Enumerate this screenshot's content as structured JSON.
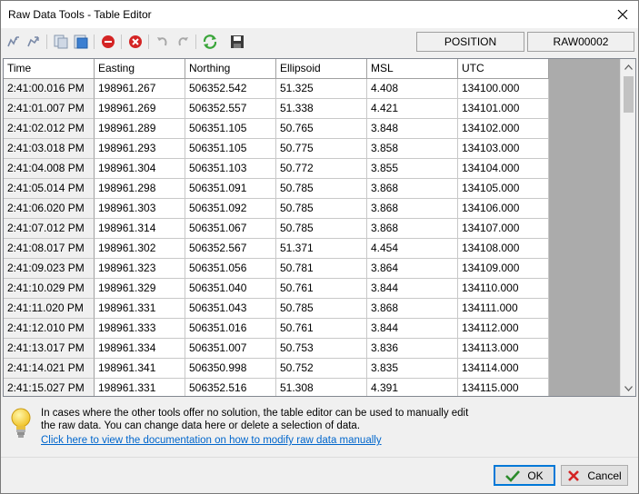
{
  "window": {
    "title": "Raw Data Tools - Table Editor"
  },
  "toolbar": {
    "position_label": "POSITION",
    "record_label": "RAW00002",
    "icons": [
      "split-icon",
      "merge-icon",
      "copy-icon",
      "paste-icon",
      "stop-icon",
      "delete-icon",
      "undo-icon",
      "redo-icon",
      "refresh-icon",
      "save-icon"
    ]
  },
  "table": {
    "columns": [
      "Time",
      "Easting",
      "Northing",
      "Ellipsoid",
      "MSL",
      "UTC"
    ],
    "rows": [
      [
        "2:41:00.016 PM",
        "198961.267",
        "506352.542",
        "51.325",
        "4.408",
        "134100.000"
      ],
      [
        "2:41:01.007 PM",
        "198961.269",
        "506352.557",
        "51.338",
        "4.421",
        "134101.000"
      ],
      [
        "2:41:02.012 PM",
        "198961.289",
        "506351.105",
        "50.765",
        "3.848",
        "134102.000"
      ],
      [
        "2:41:03.018 PM",
        "198961.293",
        "506351.105",
        "50.775",
        "3.858",
        "134103.000"
      ],
      [
        "2:41:04.008 PM",
        "198961.304",
        "506351.103",
        "50.772",
        "3.855",
        "134104.000"
      ],
      [
        "2:41:05.014 PM",
        "198961.298",
        "506351.091",
        "50.785",
        "3.868",
        "134105.000"
      ],
      [
        "2:41:06.020 PM",
        "198961.303",
        "506351.092",
        "50.785",
        "3.868",
        "134106.000"
      ],
      [
        "2:41:07.012 PM",
        "198961.314",
        "506351.067",
        "50.785",
        "3.868",
        "134107.000"
      ],
      [
        "2:41:08.017 PM",
        "198961.302",
        "506352.567",
        "51.371",
        "4.454",
        "134108.000"
      ],
      [
        "2:41:09.023 PM",
        "198961.323",
        "506351.056",
        "50.781",
        "3.864",
        "134109.000"
      ],
      [
        "2:41:10.029 PM",
        "198961.329",
        "506351.040",
        "50.761",
        "3.844",
        "134110.000"
      ],
      [
        "2:41:11.020 PM",
        "198961.331",
        "506351.043",
        "50.785",
        "3.868",
        "134111.000"
      ],
      [
        "2:41:12.010 PM",
        "198961.333",
        "506351.016",
        "50.761",
        "3.844",
        "134112.000"
      ],
      [
        "2:41:13.017 PM",
        "198961.334",
        "506351.007",
        "50.753",
        "3.836",
        "134113.000"
      ],
      [
        "2:41:14.021 PM",
        "198961.341",
        "506350.998",
        "50.752",
        "3.835",
        "134114.000"
      ],
      [
        "2:41:15.027 PM",
        "198961.331",
        "506352.516",
        "51.308",
        "4.391",
        "134115.000"
      ]
    ]
  },
  "info": {
    "line1": "In cases where the other tools offer no solution, the table editor can be used to manually edit",
    "line2": "the raw data. You can change data here or delete a selection of data.",
    "link": "Click here to view the documentation on how to modify raw data manually"
  },
  "buttons": {
    "ok": "OK",
    "cancel": "Cancel"
  },
  "colors": {
    "grid_background": "#ababab",
    "link": "#0066cc",
    "accent": "#0078d7"
  }
}
